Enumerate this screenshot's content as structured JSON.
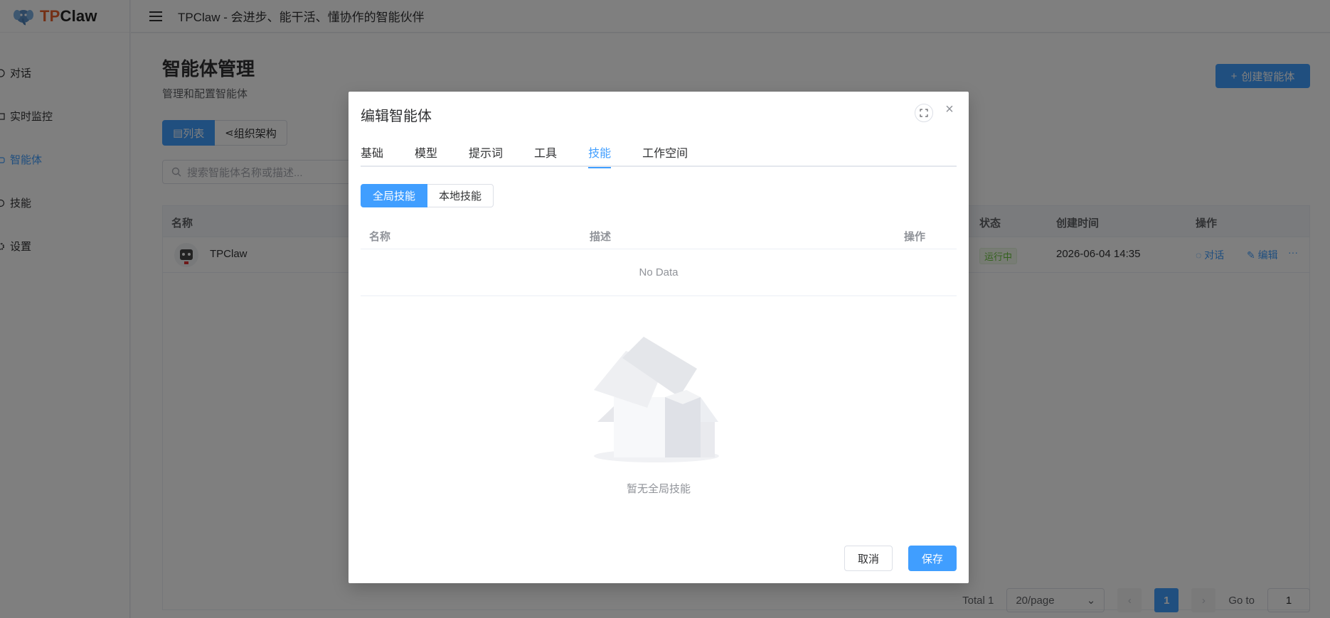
{
  "app": {
    "logo_prefix": "TP",
    "logo_suffix": "Claw",
    "header_title": "TPClaw - 会进步、能干活、懂协作的智能伙伴"
  },
  "sidebar": {
    "items": [
      {
        "label": "对话",
        "icon": "chat-icon"
      },
      {
        "label": "实时监控",
        "icon": "monitor-icon"
      },
      {
        "label": "智能体",
        "icon": "agent-icon",
        "active": true
      },
      {
        "label": "技能",
        "icon": "skill-icon"
      },
      {
        "label": "设置",
        "icon": "gear-icon"
      }
    ]
  },
  "main": {
    "title": "智能体管理",
    "subtitle": "管理和配置智能体",
    "create_label": "创建智能体",
    "view_list": "列表",
    "view_org": "组织架构",
    "search_placeholder": "搜索智能体名称或描述...",
    "columns": {
      "name": "名称",
      "status": "状态",
      "created": "创建时间",
      "actions": "操作"
    },
    "rows": [
      {
        "name": "TPClaw",
        "status": "运行中",
        "created": "2026-06-04 14:35",
        "chat": "对话",
        "edit": "编辑",
        "more": "···"
      }
    ],
    "pager": {
      "total": "Total 1",
      "page_size": "20/page",
      "current": "1",
      "goto_label": "Go to",
      "goto_value": "1"
    }
  },
  "dialog": {
    "title": "编辑智能体",
    "tabs": [
      "基础",
      "模型",
      "提示词",
      "工具",
      "技能",
      "工作空间"
    ],
    "active_tab": 4,
    "skill_global": "全局技能",
    "skill_local": "本地技能",
    "columns": {
      "name": "名称",
      "desc": "描述",
      "actions": "操作"
    },
    "no_data": "No Data",
    "empty_text": "暂无全局技能",
    "cancel": "取消",
    "save": "保存"
  },
  "colors": {
    "primary": "#409eff",
    "success": "#67c23a",
    "logo_accent": "#e8612c"
  }
}
